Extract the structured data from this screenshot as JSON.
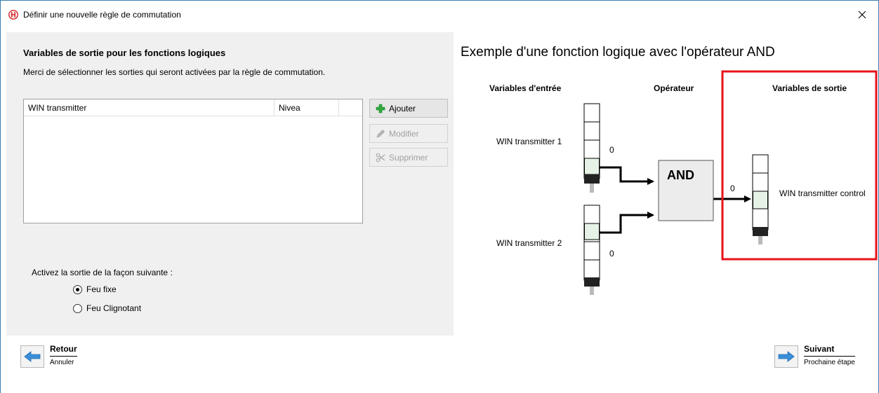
{
  "window": {
    "title": "Définir une nouvelle règle de commutation"
  },
  "left": {
    "heading": "Variables de sortie pour les fonctions logiques",
    "subheading": "Merci de sélectionner les sorties qui seront activées par la règle de commutation.",
    "list": {
      "columns": [
        "WIN transmitter",
        "Nivea",
        ""
      ],
      "rows": []
    },
    "buttons": {
      "add": "Ajouter",
      "edit": "Modifier",
      "delete": "Supprimer"
    },
    "activate_label": "Activez la sortie de la façon suivante :",
    "options": [
      {
        "label": "Feu fixe",
        "checked": true
      },
      {
        "label": "Feu Clignotant",
        "checked": false
      }
    ]
  },
  "right": {
    "title": "Exemple d'une fonction logique avec l'opérateur AND",
    "col_inputs": "Variables d'entrée",
    "col_operator": "Opérateur",
    "col_outputs": "Variables de sortie",
    "input1": "WIN transmitter 1",
    "input2": "WIN transmitter 2",
    "input1_value": "0",
    "input2_value": "0",
    "operator": "AND",
    "output_value": "0",
    "output": "WIN transmitter control",
    "highlight_color": "#e8121a"
  },
  "nav": {
    "back_main": "Retour",
    "back_sub": "Annuler",
    "next_main": "Suivant",
    "next_sub": "Prochaine étape"
  },
  "colors": {
    "accent": "#3a8fd8",
    "add_icon": "#2eaa3a",
    "panel_bg": "#f0f0f0"
  }
}
